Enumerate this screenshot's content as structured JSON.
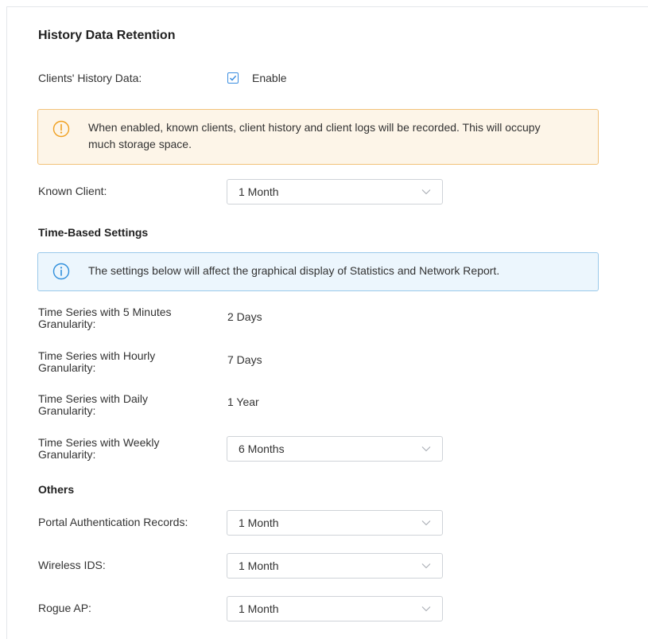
{
  "history": {
    "title": "History Data Retention",
    "clients_history_label": "Clients' History Data:",
    "enable_label": "Enable",
    "enable_checked": true,
    "warning_text": "When enabled, known clients, client history and client logs will be recorded. This will occupy much storage space.",
    "known_client_label": "Known Client:",
    "known_client_value": "1 Month"
  },
  "time_based": {
    "title": "Time-Based Settings",
    "info_text": "The settings below will affect the graphical display of Statistics and Network Report.",
    "five_min_label_1": "Time Series with 5 Minutes",
    "five_min_label_2": "Granularity:",
    "five_min_value": "2 Days",
    "hourly_label_1": "Time Series with Hourly",
    "hourly_label_2": "Granularity:",
    "hourly_value": "7 Days",
    "daily_label_1": "Time Series with Daily",
    "daily_label_2": "Granularity:",
    "daily_value": "1 Year",
    "weekly_label_1": "Time Series with Weekly",
    "weekly_label_2": "Granularity:",
    "weekly_value": "6 Months"
  },
  "others": {
    "title": "Others",
    "portal_label": "Portal Authentication Records:",
    "portal_value": "1 Month",
    "wids_label": "Wireless IDS:",
    "wids_value": "1 Month",
    "rogue_label": "Rogue AP:",
    "rogue_value": "1 Month"
  },
  "colors": {
    "warning_icon": "#f0a020",
    "info_icon": "#2f8fdc",
    "checkbox_border": "#3a8de0"
  },
  "icons": {
    "warning": "exclamation-circle-icon",
    "info": "info-circle-icon",
    "dropdown": "chevron-down-icon",
    "check": "checkmark-icon"
  }
}
